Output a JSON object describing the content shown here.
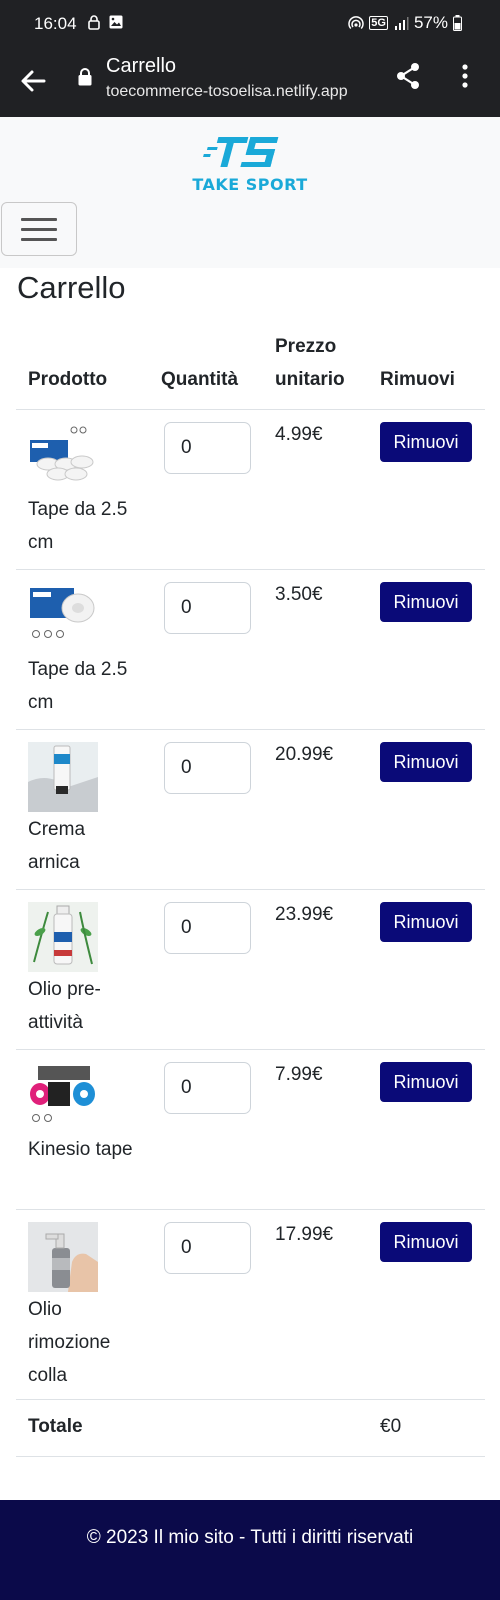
{
  "status_bar": {
    "time": "16:04",
    "network": "5G",
    "battery": "57%"
  },
  "browser": {
    "title": "Carrello",
    "url": "toecommerce-tosoelisa.netlify.app"
  },
  "header": {
    "logo_text": "TAKE SPORT",
    "brand_color": "#1aa9d8"
  },
  "cart": {
    "heading": "Carrello",
    "columns": {
      "product": "Prodotto",
      "quantity": "Quantità",
      "price_line1": "Prezzo",
      "price_line2": "unitario",
      "remove": "Rimuovi"
    },
    "items": [
      {
        "name": "Tape da 2.5 cm",
        "quantity": "0",
        "price": "4.99€",
        "remove_label": "Rimuovi"
      },
      {
        "name": "Tape da 2.5 cm",
        "quantity": "0",
        "price": "3.50€",
        "remove_label": "Rimuovi"
      },
      {
        "name": "Crema arnica",
        "quantity": "0",
        "price": "20.99€",
        "remove_label": "Rimuovi"
      },
      {
        "name": "Olio pre-attività",
        "quantity": "0",
        "price": "23.99€",
        "remove_label": "Rimuovi"
      },
      {
        "name": "Kinesio tape",
        "quantity": "0",
        "price": "7.99€",
        "remove_label": "Rimuovi"
      },
      {
        "name": "Olio rimozione colla",
        "quantity": "0",
        "price": "17.99€",
        "remove_label": "Rimuovi"
      }
    ],
    "total_label": "Totale",
    "total_value": "€0",
    "button_color": "#0a0a78"
  },
  "footer": {
    "text": "© 2023 Il mio sito - Tutti i diritti riservati",
    "color": "#0b0a4a"
  }
}
